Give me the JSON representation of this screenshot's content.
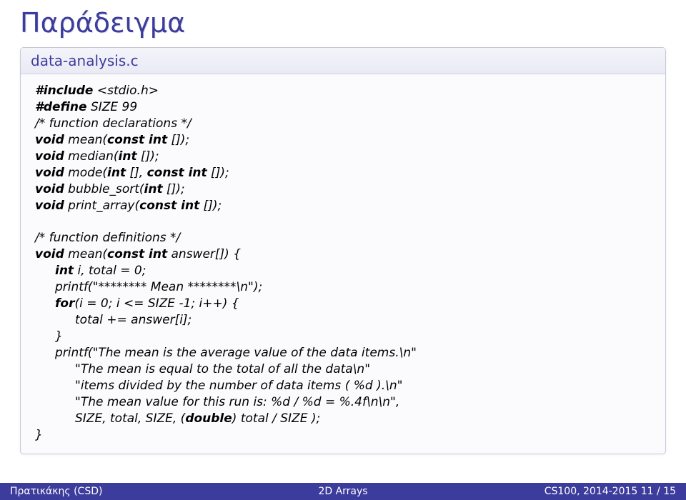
{
  "slide": {
    "title": "Παράδειγμα"
  },
  "code": {
    "filename": "data-analysis.c",
    "l01a": "#include",
    "l01b": " <stdio.h>",
    "l02a": "#define",
    "l02b": " SIZE 99",
    "l03": "/* function declarations */",
    "l04a": "void",
    "l04b": " mean(",
    "l04c": "const int",
    "l04d": " []);",
    "l05a": "void",
    "l05b": " median(",
    "l05c": "int",
    "l05d": " []);",
    "l06a": "void",
    "l06b": " mode(",
    "l06c": "int",
    "l06d": " [], ",
    "l06e": "const int",
    "l06f": " []);",
    "l07a": "void",
    "l07b": " bubble_sort(",
    "l07c": "int",
    "l07d": " []);",
    "l08a": "void",
    "l08b": " print_array(",
    "l08c": "const int",
    "l08d": " []);",
    "l09": " ",
    "l10": "/* function definitions */",
    "l11a": "void",
    "l11b": " mean(",
    "l11c": "const int",
    "l11d": " answer[]) {",
    "l12a": "int",
    "l12b": " i, total = 0;",
    "l13a": "printf(",
    "l13b": "\"******** Mean ********\\n\"",
    "l13c": ");",
    "l14a": "for",
    "l14b": "(i = 0; i <= SIZE -1; i++) {",
    "l15": "total += answer[i];",
    "l16": "}",
    "l17a": "printf(",
    "l17b": "\"The mean is the average value of the data items.\\n\"",
    "l18": "\"The mean is equal to the total of all the data\\n\"",
    "l19": "\"items divided by the number of data items ( %d ).\\n\"",
    "l20": "\"The mean value for this run is: %d / %d = %.4f\\n\\n\"",
    "l20b": ",",
    "l21a": "SIZE, total, SIZE, (",
    "l21b": "double",
    "l21c": ") total / SIZE );",
    "l22": "}"
  },
  "footer": {
    "left": "Πρατικάκης (CSD)",
    "center": "2D Arrays",
    "right": "CS100, 2014-2015     11 / 15"
  }
}
